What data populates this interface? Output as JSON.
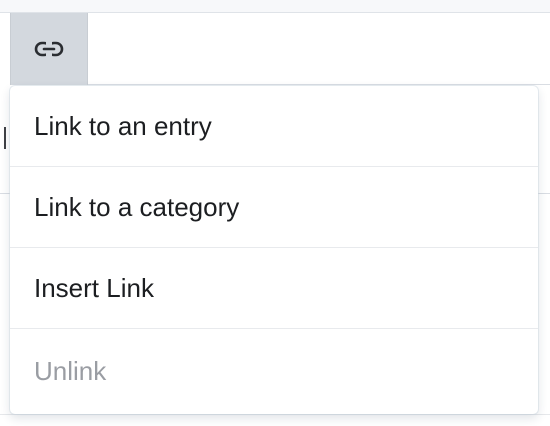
{
  "toolbar": {
    "link_button_icon": "link-icon"
  },
  "menu": {
    "items": [
      {
        "label": "Link to an entry",
        "disabled": false
      },
      {
        "label": "Link to a category",
        "disabled": false
      },
      {
        "label": "Insert Link",
        "disabled": false
      },
      {
        "label": "Unlink",
        "disabled": true
      }
    ]
  },
  "colors": {
    "active_button_bg": "#d3d8de",
    "text": "#1c1e21",
    "disabled_text": "#9a9da3",
    "divider": "#e8eaed"
  }
}
